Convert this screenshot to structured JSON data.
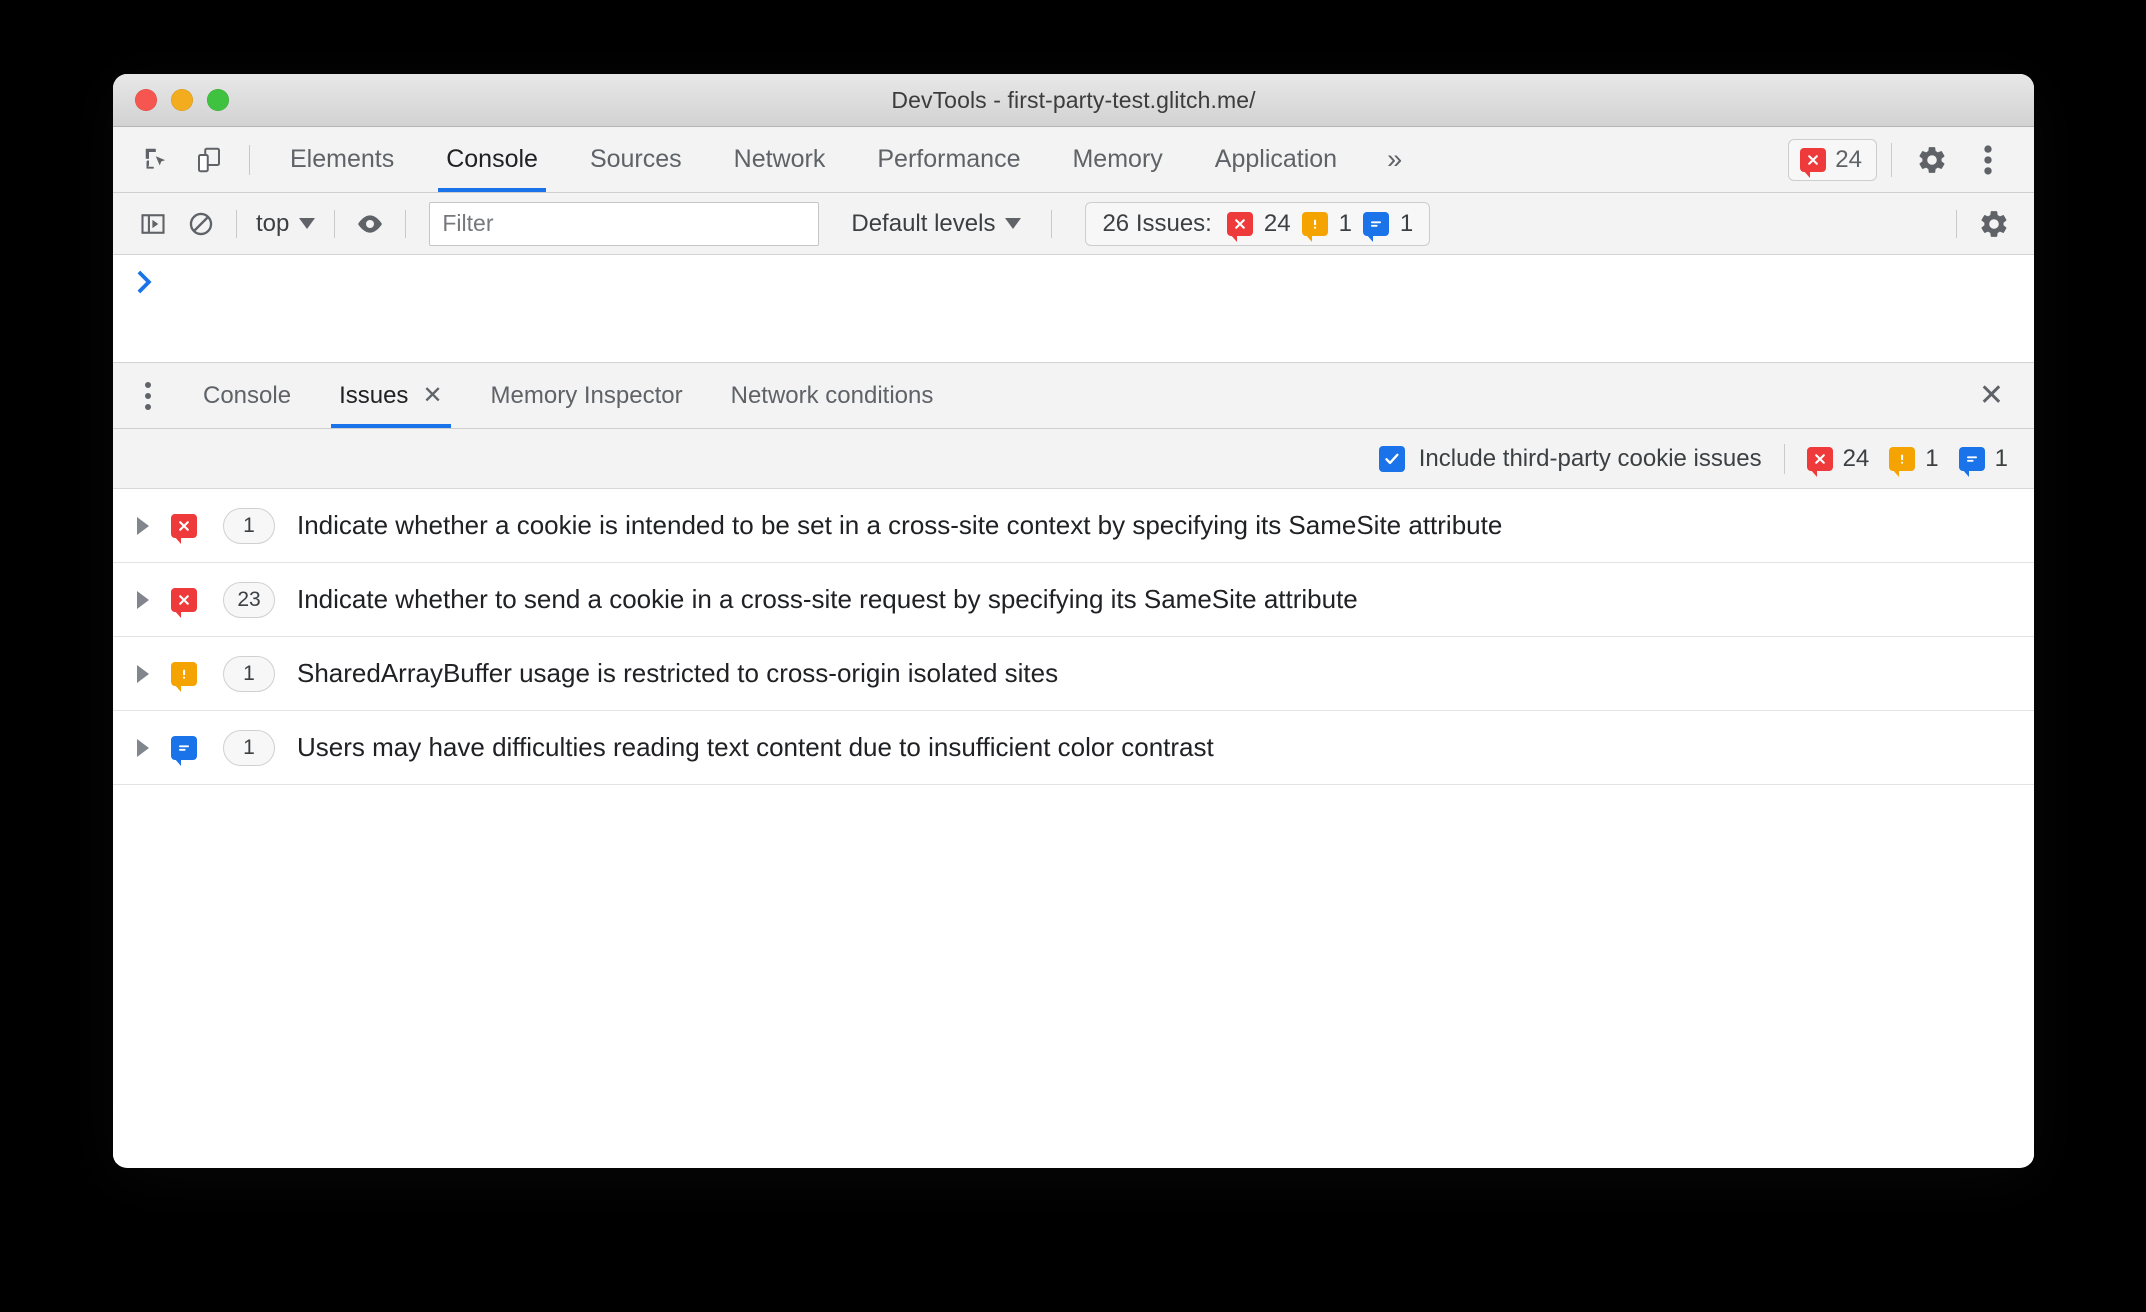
{
  "window": {
    "title": "DevTools - first-party-test.glitch.me/",
    "traffic_lights": [
      "close",
      "minimize",
      "maximize"
    ]
  },
  "main_tabbar": {
    "icons": [
      "inspect-element-icon",
      "device-toolbar-icon"
    ],
    "tabs": [
      {
        "label": "Elements",
        "active": false
      },
      {
        "label": "Console",
        "active": true
      },
      {
        "label": "Sources",
        "active": false
      },
      {
        "label": "Network",
        "active": false
      },
      {
        "label": "Performance",
        "active": false
      },
      {
        "label": "Memory",
        "active": false
      },
      {
        "label": "Application",
        "active": false
      }
    ],
    "more_tabs": "»",
    "error_badge": {
      "count": "24",
      "icon": "error-bubble-icon"
    },
    "settings_icon": "gear-icon",
    "menu_icon": "kebab-menu-icon"
  },
  "console_toolbar": {
    "sidebar_toggle_icon": "console-sidebar-icon",
    "clear_icon": "clear-console-icon",
    "context_selector": "top",
    "eye_icon": "live-expression-icon",
    "filter_placeholder": "Filter",
    "filter_value": "",
    "levels_selector": "Default levels",
    "issues_label": "26 Issues:",
    "issue_counts": {
      "errors": "24",
      "warnings": "1",
      "info": "1"
    },
    "settings_icon": "gear-icon"
  },
  "console_output": {
    "prompt": "prompt-chevron-icon"
  },
  "drawer": {
    "kebab_icon": "drawer-menu-icon",
    "tabs": [
      {
        "label": "Console",
        "active": false,
        "closable": false
      },
      {
        "label": "Issues",
        "active": true,
        "closable": true,
        "close_glyph": "✕"
      },
      {
        "label": "Memory Inspector",
        "active": false,
        "closable": false
      },
      {
        "label": "Network conditions",
        "active": false,
        "closable": false
      }
    ],
    "close_glyph": "✕"
  },
  "issues_toolbar": {
    "checkbox_label": "Include third-party cookie issues",
    "checkbox_checked": true,
    "counts": {
      "errors": "24",
      "warnings": "1",
      "info": "1"
    }
  },
  "issues": [
    {
      "severity": "error",
      "count": "1",
      "title": "Indicate whether a cookie is intended to be set in a cross-site context by specifying its SameSite attribute"
    },
    {
      "severity": "error",
      "count": "23",
      "title": "Indicate whether to send a cookie in a cross-site request by specifying its SameSite attribute"
    },
    {
      "severity": "warning",
      "count": "1",
      "title": "SharedArrayBuffer usage is restricted to cross-origin isolated sites"
    },
    {
      "severity": "info",
      "count": "1",
      "title": "Users may have difficulties reading text content due to insufficient color contrast"
    }
  ],
  "colors": {
    "error": "#ee3a3a",
    "warning": "#f5a300",
    "info": "#1a73e8",
    "accent": "#1a73e8",
    "titlebar": "#dcdcdc",
    "toolbar": "#f3f3f3"
  }
}
